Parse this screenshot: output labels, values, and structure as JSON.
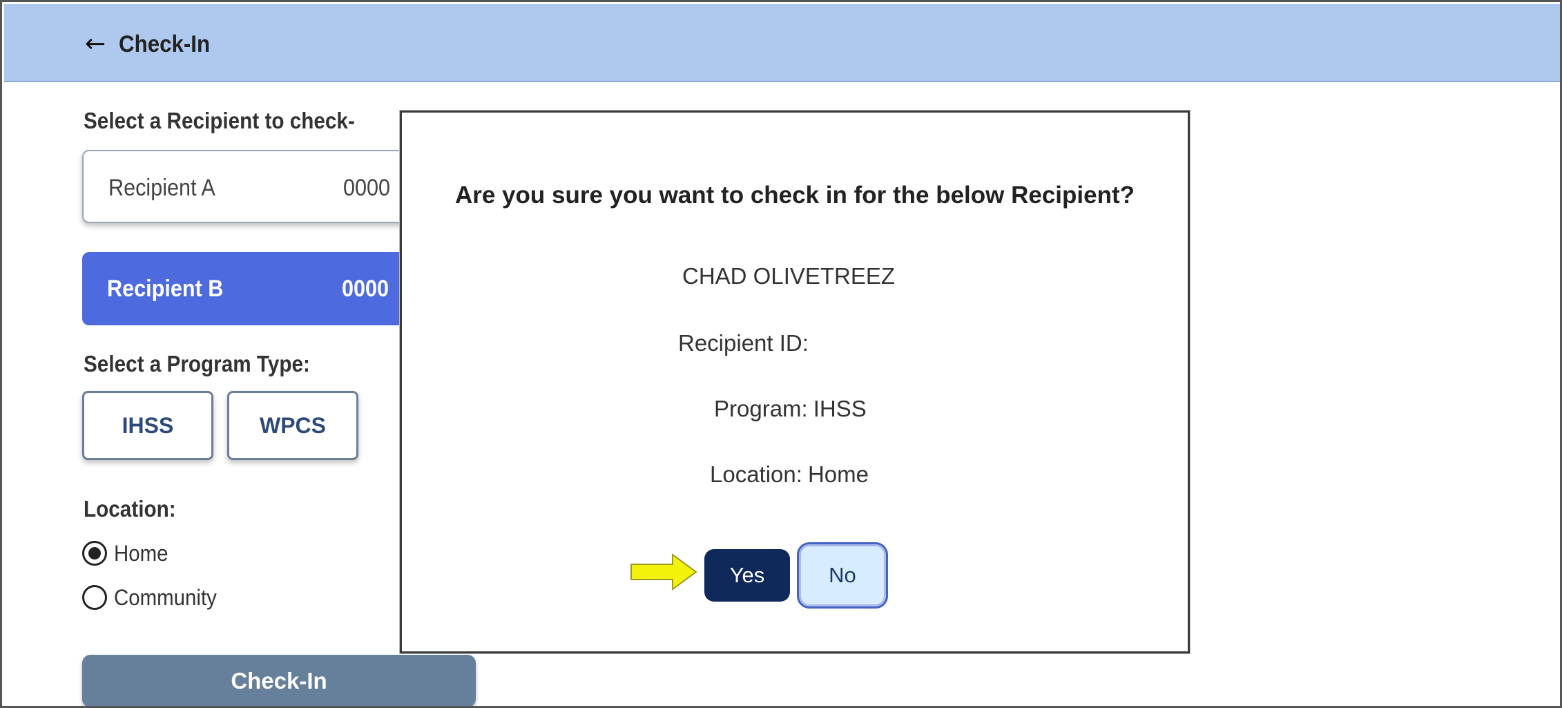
{
  "header": {
    "back_icon": "arrow-left-icon",
    "title": "Check-In"
  },
  "form": {
    "recipient_label": "Select a Recipient to check-",
    "recipients": [
      {
        "name": "Recipient A",
        "id_partial": "0000",
        "selected": false
      },
      {
        "name": "Recipient B",
        "id_partial": "0000",
        "selected": true
      }
    ],
    "program_label": "Select a Program Type:",
    "programs": [
      "IHSS",
      "WPCS"
    ],
    "location_label": "Location:",
    "locations": [
      {
        "label": "Home",
        "checked": true
      },
      {
        "label": "Community",
        "checked": false
      }
    ],
    "checkin_button": "Check-In"
  },
  "modal": {
    "question": "Are you sure you want to check in for the below Recipient?",
    "recipient_name": "CHAD OLIVETREEZ",
    "recipient_id_label": "Recipient ID:",
    "recipient_id_value": "",
    "program_label": "Program:",
    "program_value": "IHSS",
    "location_label": "Location:",
    "location_value": "Home",
    "yes_button": "Yes",
    "no_button": "No",
    "pointer_icon": "yellow-arrow-right-icon"
  },
  "colors": {
    "header_bg": "#afc8ee",
    "selected_recipient": "#4d6bde",
    "checkin_button": "#667f9b",
    "yes_button": "#0f2a5a",
    "no_button_bg": "#d8ecff",
    "pointer_arrow": "#f2f20a"
  }
}
